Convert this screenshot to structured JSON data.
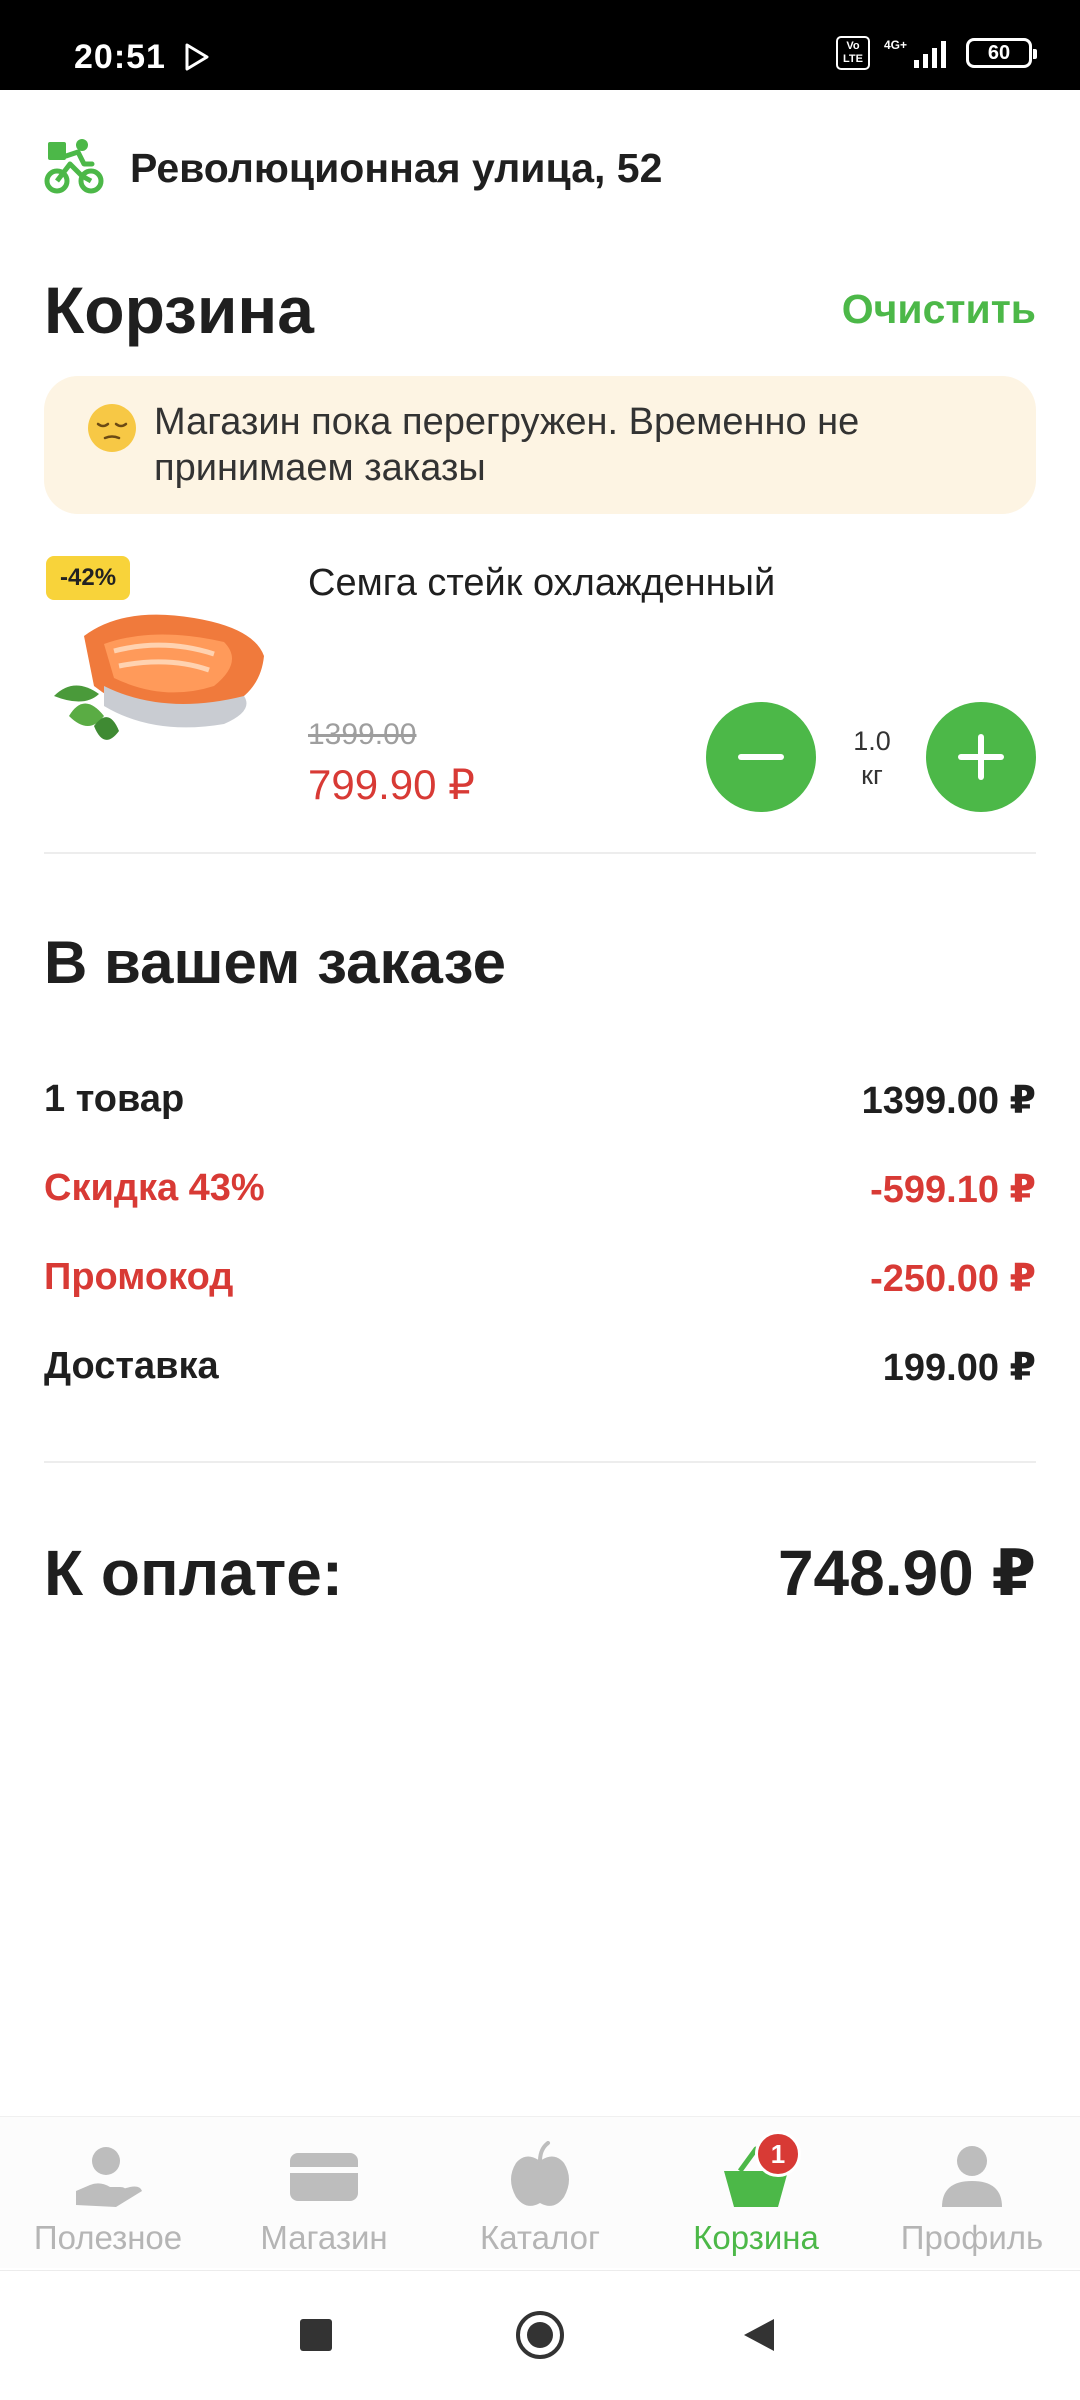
{
  "status_bar": {
    "time": "20:51",
    "volte": "Vo LTE",
    "network": "4G+",
    "battery": "60"
  },
  "header": {
    "address": "Революционная улица, 52"
  },
  "cart": {
    "title": "Корзина",
    "clear_label": "Очистить",
    "notice": "Магазин пока перегружен. Временно не принимаем заказы",
    "items": [
      {
        "name": "Семга стейк охлажденный",
        "discount_badge": "-42%",
        "old_price": "1399.00",
        "new_price": "799.90 ₽",
        "qty_value": "1.0",
        "qty_unit": "кг"
      }
    ]
  },
  "summary": {
    "title": "В вашем заказе",
    "rows": [
      {
        "label": "1 товар",
        "value": "1399.00 ₽"
      },
      {
        "label": "Скидка 43%",
        "value": "-599.10 ₽"
      },
      {
        "label": "Промокод",
        "value": "-250.00 ₽"
      },
      {
        "label": "Доставка",
        "value": "199.00 ₽"
      }
    ],
    "total_label": "К оплате:",
    "total_value": "748.90 ₽"
  },
  "tabbar": {
    "tabs": [
      {
        "label": "Полезное",
        "icon": "hand-heart-icon"
      },
      {
        "label": "Магазин",
        "icon": "card-icon"
      },
      {
        "label": "Каталог",
        "icon": "apple-icon"
      },
      {
        "label": "Корзина",
        "icon": "basket-icon",
        "badge": "1",
        "active": true
      },
      {
        "label": "Профиль",
        "icon": "person-icon"
      }
    ]
  },
  "colors": {
    "accent": "#4cb848",
    "danger": "#d83a35",
    "notice_bg": "#fdf4e3",
    "badge": "#f8d33a"
  }
}
